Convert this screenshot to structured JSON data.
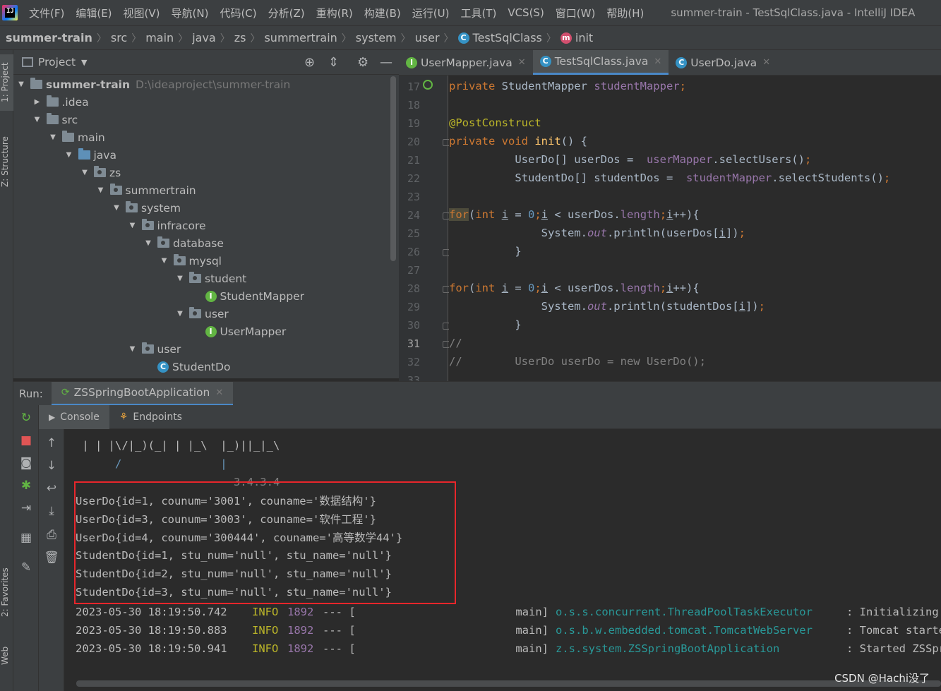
{
  "menu": {
    "items": [
      "文件(F)",
      "编辑(E)",
      "视图(V)",
      "导航(N)",
      "代码(C)",
      "分析(Z)",
      "重构(R)",
      "构建(B)",
      "运行(U)",
      "工具(T)",
      "VCS(S)",
      "窗口(W)",
      "帮助(H)"
    ],
    "window_title": "summer-train - TestSqlClass.java - IntelliJ IDEA"
  },
  "breadcrumb": [
    "summer-train",
    "src",
    "main",
    "java",
    "zs",
    "summertrain",
    "system",
    "user",
    "TestSqlClass",
    "init"
  ],
  "left_strip": {
    "project": "1: Project",
    "structure": "Z: Structure",
    "favorites": "2: Favorites",
    "web": "Web"
  },
  "project": {
    "title": "Project",
    "root_name": "summer-train",
    "root_path": "D:\\ideaproject\\summer-train",
    "tree": [
      {
        "label": ".idea",
        "depth": 1,
        "arrow": "right",
        "icon": "folder"
      },
      {
        "label": "src",
        "depth": 1,
        "arrow": "down",
        "icon": "folder"
      },
      {
        "label": "main",
        "depth": 2,
        "arrow": "down",
        "icon": "folder"
      },
      {
        "label": "java",
        "depth": 3,
        "arrow": "down",
        "icon": "folder-blue"
      },
      {
        "label": "zs",
        "depth": 4,
        "arrow": "down",
        "icon": "package"
      },
      {
        "label": "summertrain",
        "depth": 5,
        "arrow": "down",
        "icon": "package"
      },
      {
        "label": "system",
        "depth": 6,
        "arrow": "down",
        "icon": "package"
      },
      {
        "label": "infracore",
        "depth": 7,
        "arrow": "down",
        "icon": "package"
      },
      {
        "label": "database",
        "depth": 8,
        "arrow": "down",
        "icon": "package"
      },
      {
        "label": "mysql",
        "depth": 9,
        "arrow": "down",
        "icon": "package"
      },
      {
        "label": "student",
        "depth": 10,
        "arrow": "down",
        "icon": "package"
      },
      {
        "label": "StudentMapper",
        "depth": 11,
        "arrow": "none",
        "icon": "interface"
      },
      {
        "label": "user",
        "depth": 10,
        "arrow": "down",
        "icon": "package"
      },
      {
        "label": "UserMapper",
        "depth": 11,
        "arrow": "none",
        "icon": "interface"
      },
      {
        "label": "user",
        "depth": 7,
        "arrow": "down",
        "icon": "package"
      },
      {
        "label": "StudentDo",
        "depth": 8,
        "arrow": "none",
        "icon": "class"
      }
    ]
  },
  "editor": {
    "tabs": [
      {
        "label": "UserMapper.java",
        "icon": "interface",
        "active": false
      },
      {
        "label": "TestSqlClass.java",
        "icon": "class",
        "active": true
      },
      {
        "label": "UserDo.java",
        "icon": "class",
        "active": false
      }
    ],
    "line_numbers": [
      "17",
      "18",
      "19",
      "20",
      "21",
      "22",
      "23",
      "24",
      "25",
      "26",
      "27",
      "28",
      "29",
      "30",
      "31",
      "32",
      "33"
    ],
    "current_line": "31"
  },
  "run": {
    "label": "Run:",
    "config": "ZSSpringBootApplication",
    "tabs": [
      "Console",
      "Endpoints"
    ]
  },
  "console": {
    "banner": [
      " | | |\\/|_)(_| | |_\\  |_)||_|_\\",
      "      /               |",
      "                        3.4.3.4"
    ],
    "output": [
      "UserDo{id=1, counum='3001', couname='数据结构'}",
      "UserDo{id=3, counum='3003', couname='软件工程'}",
      "UserDo{id=4, counum='300444', couname='高等数学44'}",
      "StudentDo{id=1, stu_num='null', stu_name='null'}",
      "StudentDo{id=2, stu_num='null', stu_name='null'}",
      "StudentDo{id=3, stu_num='null', stu_name='null'}"
    ],
    "logs": [
      {
        "time": "2023-05-30 18:19:50.742",
        "level": "INFO",
        "pid": "1892",
        "sep": "--- [",
        "thread": "main]",
        "logger": "o.s.s.concurrent.ThreadPoolTaskExecutor",
        "msg": ": Initializing ExecutorSe"
      },
      {
        "time": "2023-05-30 18:19:50.883",
        "level": "INFO",
        "pid": "1892",
        "sep": "--- [",
        "thread": "main]",
        "logger": "o.s.b.w.embedded.tomcat.TomcatWebServer",
        "msg": ": Tomcat started on port("
      },
      {
        "time": "2023-05-30 18:19:50.941",
        "level": "INFO",
        "pid": "1892",
        "sep": "--- [",
        "thread": "main]",
        "logger": "z.s.system.ZSSpringBootApplication",
        "msg": ": Started ZSSpringBootApp"
      }
    ]
  },
  "watermark": "CSDN @Hachi没了",
  "colors": {
    "highlight_box": "#e8262b",
    "accent_tab": "#4a88c7"
  }
}
